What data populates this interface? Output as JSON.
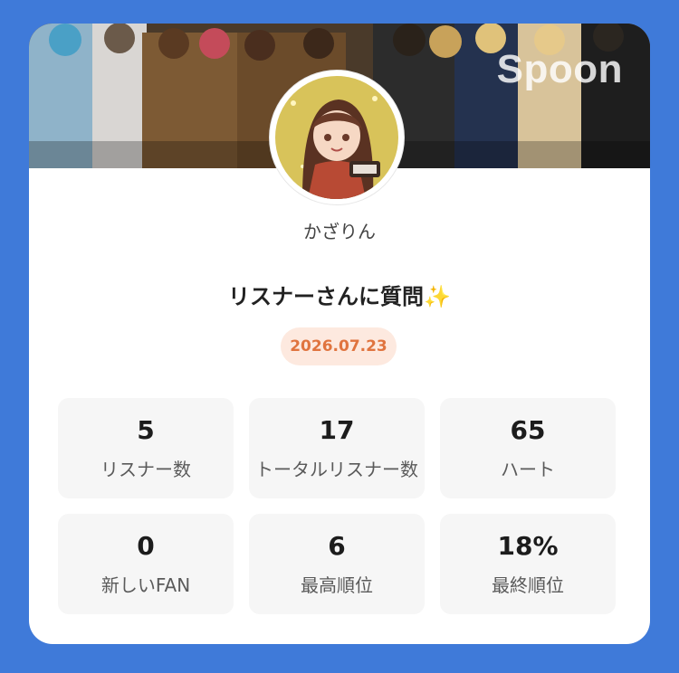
{
  "banner": {
    "brand": "Spoon"
  },
  "profile": {
    "username": "かざりん"
  },
  "post": {
    "title": "リスナーさんに質問✨",
    "date": "2026.07.23"
  },
  "stats": [
    {
      "value": "5",
      "label": "リスナー数"
    },
    {
      "value": "17",
      "label": "トータルリスナー数"
    },
    {
      "value": "65",
      "label": "ハート"
    },
    {
      "value": "0",
      "label": "新しいFAN"
    },
    {
      "value": "6",
      "label": "最高順位"
    },
    {
      "value": "18%",
      "label": "最終順位"
    }
  ],
  "colors": {
    "background": "#3f7ad9",
    "card": "#ffffff",
    "date_badge_bg": "#fde9df",
    "date_badge_text": "#e0743f",
    "stat_tile_bg": "#f6f6f6"
  }
}
